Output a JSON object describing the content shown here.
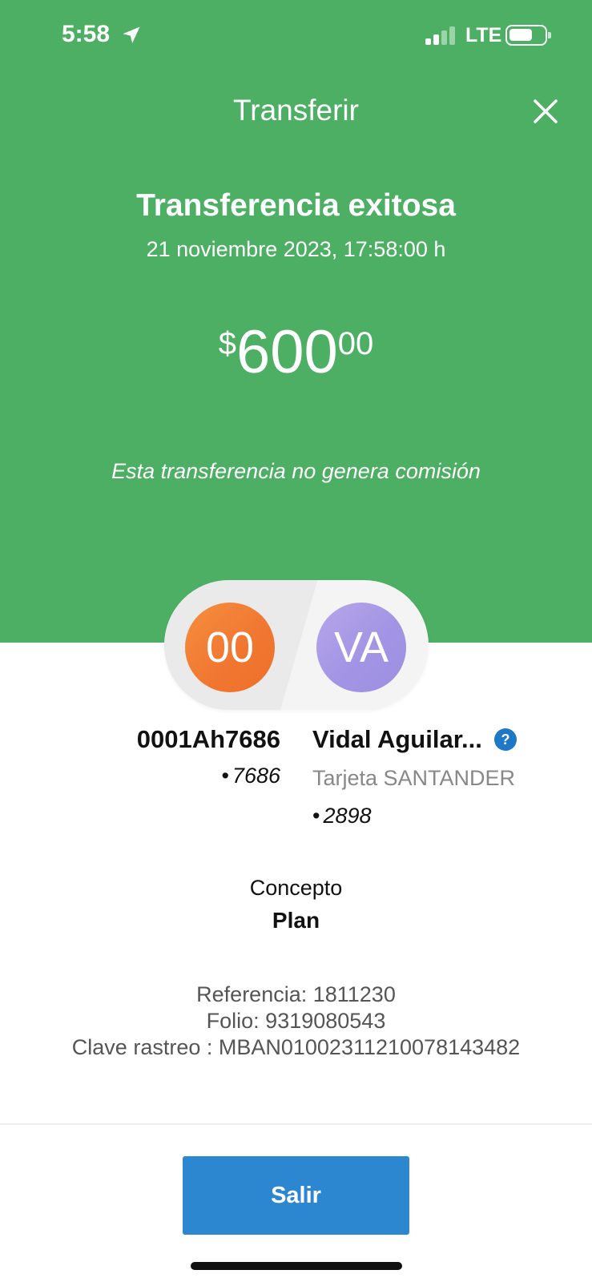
{
  "status_bar": {
    "time": "5:58",
    "network": "LTE",
    "location_icon": "location-arrow-icon",
    "signal_icon": "signal-bars-icon",
    "battery_icon": "battery-icon"
  },
  "header": {
    "title": "Transferir",
    "close_icon": "close-icon"
  },
  "result": {
    "title": "Transferencia exitosa",
    "datetime": "21 noviembre 2023, 17:58:00 h"
  },
  "amount": {
    "currency": "$",
    "integer": "600",
    "decimals": "00"
  },
  "commission_note": "Esta transferencia no genera comisión",
  "origin": {
    "initials": "00",
    "name": "0001Ah7686",
    "account_last": "7686",
    "color": "#f17832"
  },
  "destination": {
    "initials": "VA",
    "name": "Vidal Aguilar...",
    "bank": "Tarjeta SANTANDER",
    "account_last": "2898",
    "help_icon": "question-circle-icon",
    "color": "#a395e4"
  },
  "concept": {
    "label": "Concepto",
    "value": "Plan"
  },
  "references": {
    "referencia": "Referencia: 1811230",
    "folio": "Folio: 9319080543",
    "clave": "Clave rastreo : MBAN01002311210078143482"
  },
  "actions": {
    "exit_label": "Salir"
  },
  "colors": {
    "header_green": "#4caf63",
    "button_blue": "#2d86d0"
  }
}
